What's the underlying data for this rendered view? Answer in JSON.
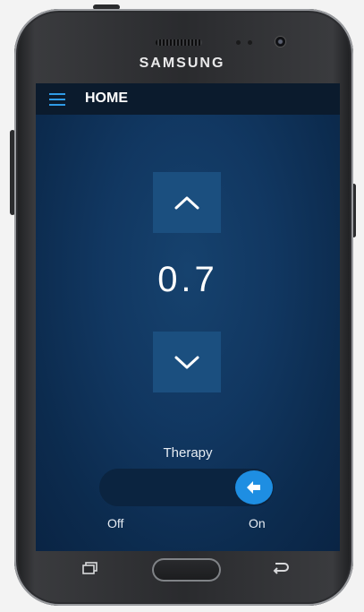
{
  "device": {
    "brand": "SAMSUNG"
  },
  "app_bar": {
    "title": "HOME",
    "menu_icon": "hamburger-menu-icon"
  },
  "dose_control": {
    "increase_icon": "chevron-up-icon",
    "value": "0.7",
    "decrease_icon": "chevron-down-icon"
  },
  "therapy": {
    "label": "Therapy",
    "off_label": "Off",
    "on_label": "On",
    "state": "on",
    "knob_icon": "arrow-left-icon"
  },
  "nav_bar": {
    "recent_icon": "recent-apps-icon",
    "home_icon": "home-button",
    "back_icon": "back-icon"
  },
  "colors": {
    "screen_bg": "#113761",
    "app_bar_bg": "#0b1b2d",
    "accent": "#1e8ee2",
    "button_bg": "#1b4f7f"
  }
}
